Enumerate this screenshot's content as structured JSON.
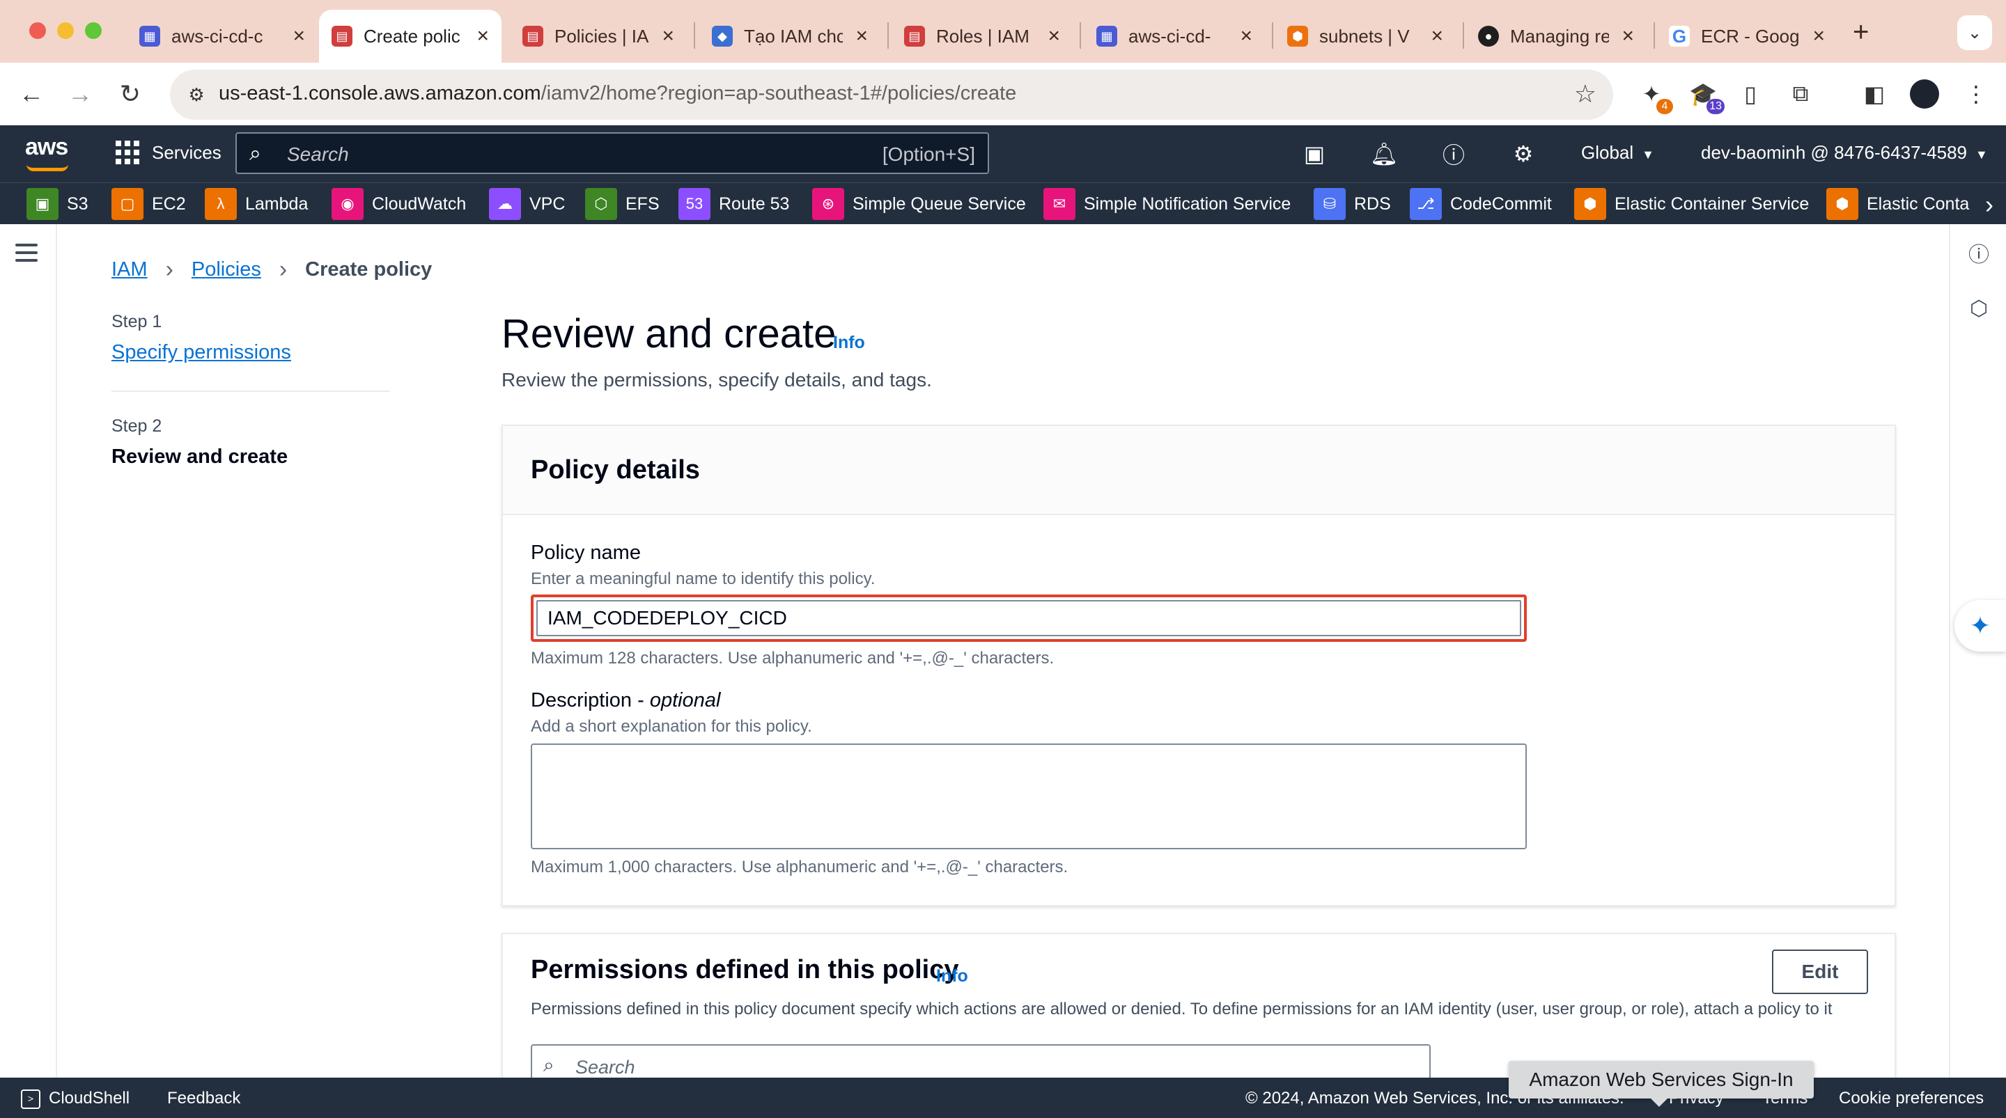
{
  "browser": {
    "tabs": [
      {
        "title": "aws-ci-cd-c",
        "icon": "aws-diagram-icon",
        "color": "#4b5bd6"
      },
      {
        "title": "Create polic",
        "icon": "iam-icon",
        "color": "#d13e3e",
        "active": true
      },
      {
        "title": "Policies | IA",
        "icon": "iam-icon",
        "color": "#d13e3e"
      },
      {
        "title": "Tạo IAM chc",
        "icon": "shield-icon",
        "color": "#3b6fd1"
      },
      {
        "title": "Roles | IAM",
        "icon": "iam-icon",
        "color": "#d13e3e"
      },
      {
        "title": "aws-ci-cd-",
        "icon": "aws-diagram-icon",
        "color": "#4b5bd6"
      },
      {
        "title": "subnets | V",
        "icon": "vpc-icon",
        "color": "#ec7211"
      },
      {
        "title": "Managing re",
        "icon": "github-icon",
        "color": "#1f1f1f"
      },
      {
        "title": "ECR - Goog",
        "icon": "google-icon",
        "color": "#ffffff"
      }
    ],
    "url_host": "us-east-1.console.aws.amazon.com",
    "url_path": "/iamv2/home?region=ap-southeast-1#/policies/create",
    "extensions": [
      {
        "name": "extension-icon",
        "badge": "4",
        "badge_color": "#e8710a"
      },
      {
        "name": "mortarboard-icon",
        "badge": "13",
        "badge_color": "#5b3fc7"
      }
    ]
  },
  "aws_nav": {
    "logo": "aws",
    "services_label": "Services",
    "search_placeholder": "Search",
    "search_shortcut": "[Option+S]",
    "region": "Global",
    "account": "dev-baominh @ 8476-6437-4589"
  },
  "favorites": [
    {
      "label": "S3",
      "color": "#3f8624",
      "glyph": "▣"
    },
    {
      "label": "EC2",
      "color": "#ed7100",
      "glyph": "▢"
    },
    {
      "label": "Lambda",
      "color": "#ed7100",
      "glyph": "λ"
    },
    {
      "label": "CloudWatch",
      "color": "#e7157b",
      "glyph": "◉"
    },
    {
      "label": "VPC",
      "color": "#8c4fff",
      "glyph": "☁"
    },
    {
      "label": "EFS",
      "color": "#3f8624",
      "glyph": "⬡"
    },
    {
      "label": "Route 53",
      "color": "#8c4fff",
      "glyph": "53"
    },
    {
      "label": "Simple Queue Service",
      "color": "#e7157b",
      "glyph": "⊛"
    },
    {
      "label": "Simple Notification Service",
      "color": "#e7157b",
      "glyph": "✉"
    },
    {
      "label": "RDS",
      "color": "#4d72f3",
      "glyph": "⛁"
    },
    {
      "label": "CodeCommit",
      "color": "#4d72f3",
      "glyph": "⎇"
    },
    {
      "label": "Elastic Container Service",
      "color": "#ed7100",
      "glyph": "⬢"
    },
    {
      "label": "Elastic Conta",
      "color": "#ed7100",
      "glyph": "⬢"
    }
  ],
  "breadcrumb": {
    "iam": "IAM",
    "policies": "Policies",
    "current": "Create policy"
  },
  "steps": {
    "step1_label": "Step 1",
    "step1_title": "Specify permissions",
    "step2_label": "Step 2",
    "step2_title": "Review and create"
  },
  "page": {
    "title": "Review and create",
    "info": "Info",
    "description": "Review the permissions, specify details, and tags."
  },
  "policy_details": {
    "title": "Policy details",
    "name_label": "Policy name",
    "name_hint": "Enter a meaningful name to identify this policy.",
    "name_value": "IAM_CODEDEPLOY_CICD",
    "name_constraint": "Maximum 128 characters. Use alphanumeric and '+=,.@-_' characters.",
    "desc_label": "Description - ",
    "desc_optional": "optional",
    "desc_hint": "Add a short explanation for this policy.",
    "desc_value": "",
    "desc_constraint": "Maximum 1,000 characters. Use alphanumeric and '+=,.@-_' characters."
  },
  "permissions": {
    "title": "Permissions defined in this policy",
    "info": "Info",
    "edit_label": "Edit",
    "description": "Permissions defined in this policy document specify which actions are allowed or denied. To define permissions for an IAM identity (user, user group, or role), attach a policy to it",
    "search_placeholder": "Search"
  },
  "footer": {
    "cloudshell": "CloudShell",
    "feedback": "Feedback",
    "copyright": "© 2024, Amazon Web Services, Inc. or its affiliates.",
    "privacy": "Privacy",
    "terms": "Terms",
    "cookie": "Cookie preferences"
  },
  "tooltip": "Amazon Web Services Sign-In"
}
